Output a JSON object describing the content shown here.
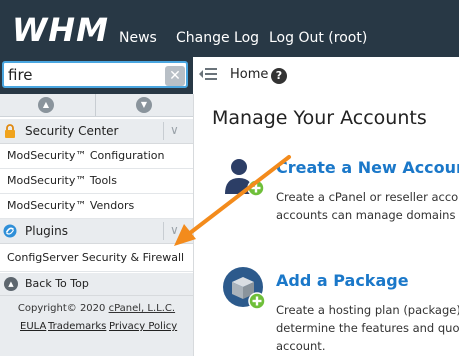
{
  "header": {
    "logo": "WHM",
    "nav": [
      "News",
      "Change Log",
      "Log Out (root)"
    ]
  },
  "sidebar": {
    "search_value": "fire",
    "categories": [
      {
        "label": "Security Center",
        "items": [
          "ModSecurity™ Configuration",
          "ModSecurity™ Tools",
          "ModSecurity™ Vendors"
        ]
      },
      {
        "label": "Plugins",
        "items": [
          "ConfigServer Security & Firewall"
        ]
      }
    ],
    "back_to_top": "Back To Top",
    "footer": {
      "copyright_prefix": "Copyright© 2020 ",
      "company": "cPanel, L.L.C.",
      "links": [
        "EULA",
        "Trademarks",
        "Privacy Policy"
      ]
    }
  },
  "breadcrumb": {
    "home": "Home"
  },
  "main": {
    "title": "Manage Your Accounts",
    "features": [
      {
        "title": "Create a New Account",
        "desc": [
          "Create a cPanel or reseller account",
          "accounts can manage domains and"
        ]
      },
      {
        "title": "Add a Package",
        "desc": [
          "Create a hosting plan (package). P",
          "determine the features and quota",
          "account."
        ]
      }
    ]
  },
  "colors": {
    "header_bg": "#283845",
    "link_blue": "#1b78c9",
    "annotation_orange": "#f38b1c",
    "sidebar_bg": "#e9ecef",
    "search_border": "#4aa6e0"
  }
}
